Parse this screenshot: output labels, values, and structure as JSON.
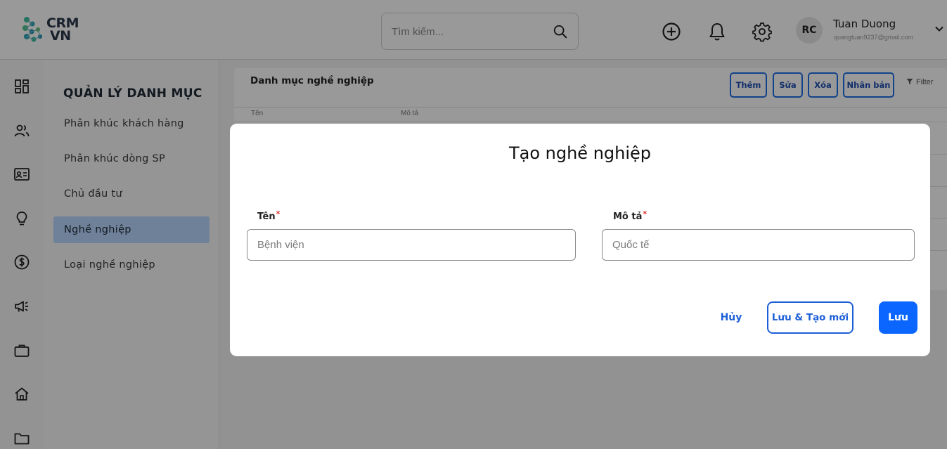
{
  "header": {
    "brand_line1": "CRM",
    "brand_line2": "VN",
    "search_placeholder": "Tìm kiếm...",
    "user_initials": "RC",
    "user_name": "Tuan Duong",
    "user_email": "quangtuan9237@gmail.com",
    "icons": [
      "add-circle-icon",
      "bell-icon",
      "gear-icon",
      "chevron-down-icon"
    ]
  },
  "rail": {
    "icons": [
      "dashboard-icon",
      "users-icon",
      "contact-card-icon",
      "lightbulb-icon",
      "dollar-icon",
      "megaphone-icon",
      "briefcase-icon",
      "home-icon",
      "folder-icon"
    ]
  },
  "sidebar": {
    "title": "QUẢN LÝ DANH MỤC",
    "items": [
      {
        "label": "Phân khúc khách hàng",
        "active": false
      },
      {
        "label": "Phân khúc dòng SP",
        "active": false
      },
      {
        "label": "Chủ đầu tư",
        "active": false
      },
      {
        "label": "Nghề nghiệp",
        "active": true
      },
      {
        "label": "Loại nghề nghiệp",
        "active": false
      }
    ]
  },
  "content": {
    "title": "Danh mục nghề nghiệp",
    "toolbar": {
      "add": "Thêm",
      "edit": "Sửa",
      "delete": "Xóa",
      "duplicate": "Nhân bản",
      "filter": "Filter"
    },
    "columns": [
      "Tên",
      "Mô tả"
    ]
  },
  "modal": {
    "title": "Tạo nghề nghiệp",
    "name_label": "Tên",
    "name_placeholder": "Bệnh viện",
    "desc_label": "Mô tả",
    "desc_placeholder": "Quốc tế",
    "required_mark": "*",
    "cancel": "Hủy",
    "save_new": "Lưu & Tạo mới",
    "save": "Lưu"
  },
  "colors": {
    "accent": "#0a66ff",
    "active_item": "#b9d7ff",
    "required": "#e02424"
  }
}
